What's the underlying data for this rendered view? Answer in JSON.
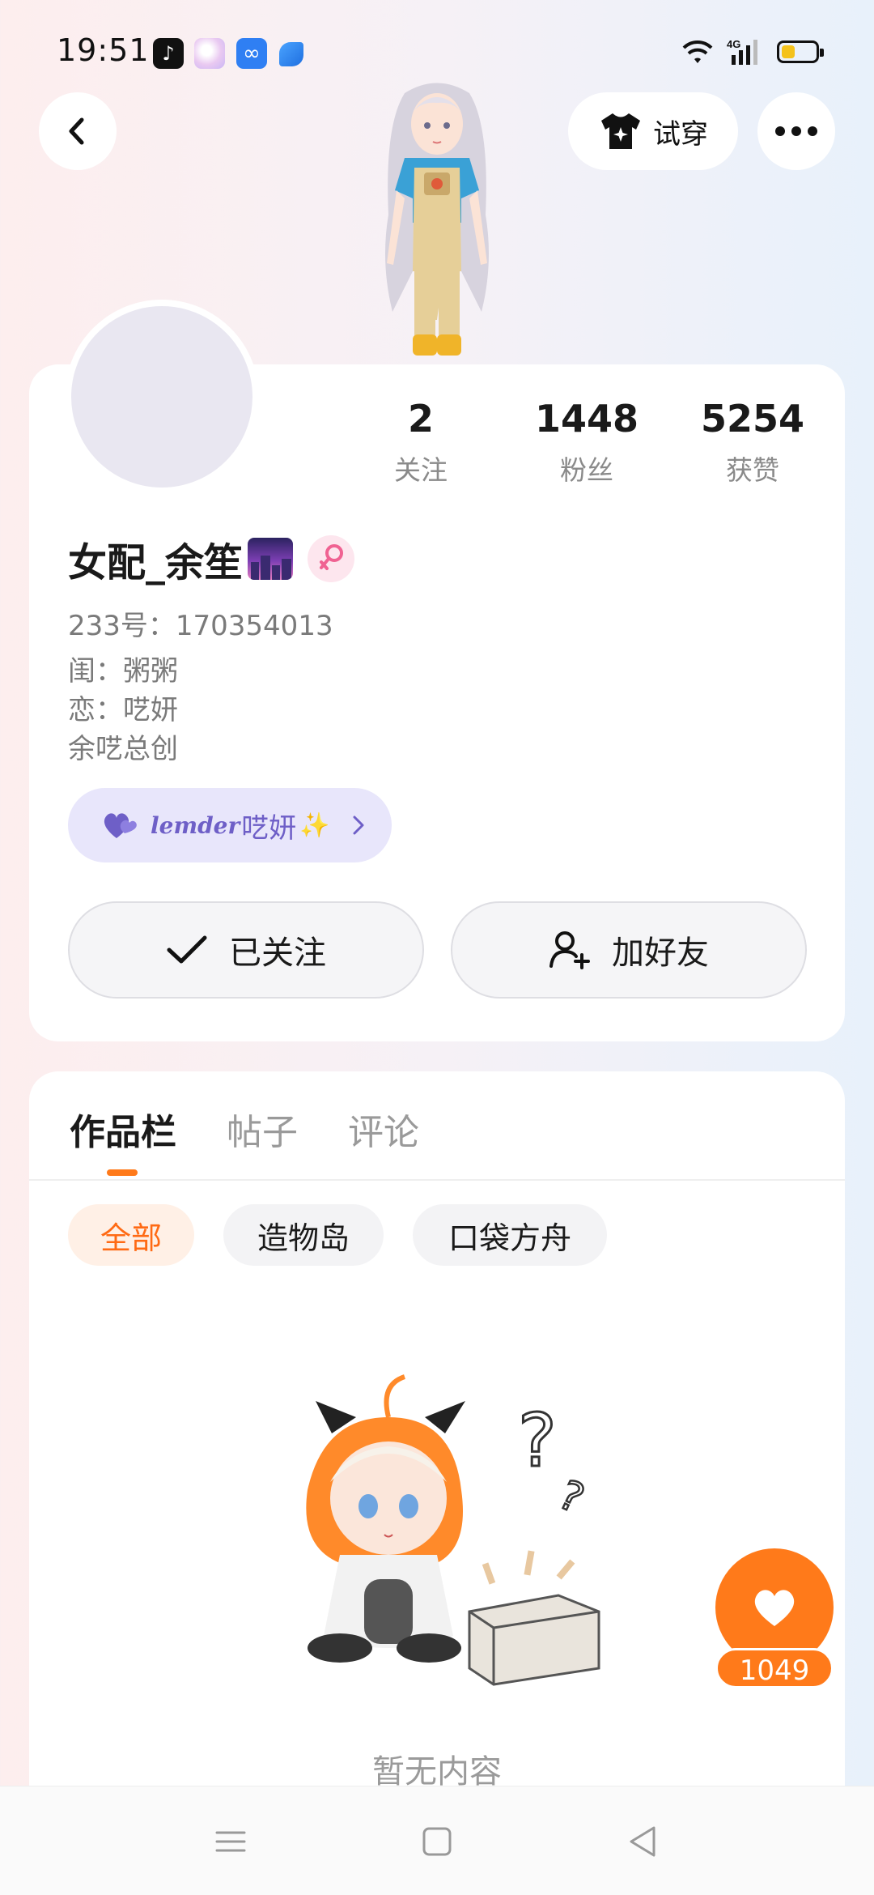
{
  "status_bar": {
    "time": "19:51",
    "network": "4G",
    "battery_level": 0.4,
    "app_icons": [
      "tiktok-icon",
      "bubble-app-icon",
      "infinity-app-icon",
      "leaf-app-icon"
    ]
  },
  "header": {
    "tryon_label": "试穿",
    "back_icon": "chevron-left-icon",
    "more_icon": "more-horizontal-icon",
    "tryon_icon": "tshirt-sparkle-icon"
  },
  "profile": {
    "stats": [
      {
        "value": "2",
        "label": "关注"
      },
      {
        "value": "1448",
        "label": "粉丝"
      },
      {
        "value": "5254",
        "label": "获赞"
      }
    ],
    "username": "女配_余笙",
    "gender_icon": "female-symbol-icon",
    "uid": "233号：170354013",
    "bio_lines": [
      "闺：粥粥",
      "恋：呓妍",
      "余呓总创"
    ],
    "tag": {
      "script": "lemder",
      "text": "呓妍",
      "emoji": "✨"
    },
    "followed_label": "已关注",
    "add_friend_label": "加好友"
  },
  "works": {
    "tabs": [
      "作品栏",
      "帖子",
      "评论"
    ],
    "active_tab": 0,
    "chips": [
      "全部",
      "造物岛",
      "口袋方舟"
    ],
    "active_chip": 0,
    "empty_text": "暂无内容"
  },
  "like_fab": {
    "count": "1049"
  },
  "colors": {
    "accent": "#ff7a1a",
    "tag_purple": "#6e5fc7",
    "tag_bg": "#e8e6fb",
    "battery": "#f4c21b"
  }
}
